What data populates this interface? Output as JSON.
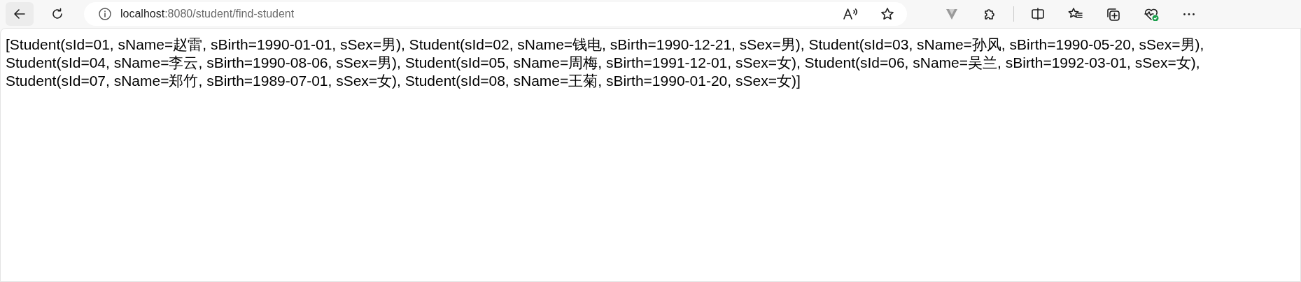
{
  "browser": {
    "address": {
      "host": "localhost",
      "path": ":8080/student/find-student"
    },
    "toolbar_icons": [
      {
        "kind": "v"
      },
      {
        "kind": "puzzle"
      },
      {
        "kind": "divider"
      },
      {
        "kind": "split"
      },
      {
        "kind": "favorites"
      },
      {
        "kind": "collections"
      },
      {
        "kind": "health"
      },
      {
        "kind": "more"
      }
    ]
  },
  "page": {
    "body_text": "[Student(sId=01, sName=赵雷, sBirth=1990-01-01, sSex=男), Student(sId=02, sName=钱电, sBirth=1990-12-21, sSex=男), Student(sId=03, sName=孙风, sBirth=1990-05-20, sSex=男), Student(sId=04, sName=李云, sBirth=1990-08-06, sSex=男), Student(sId=05, sName=周梅, sBirth=1991-12-01, sSex=女), Student(sId=06, sName=吴兰, sBirth=1992-03-01, sSex=女), Student(sId=07, sName=郑竹, sBirth=1989-07-01, sSex=女), Student(sId=08, sName=王菊, sBirth=1990-01-20, sSex=女)]"
  }
}
